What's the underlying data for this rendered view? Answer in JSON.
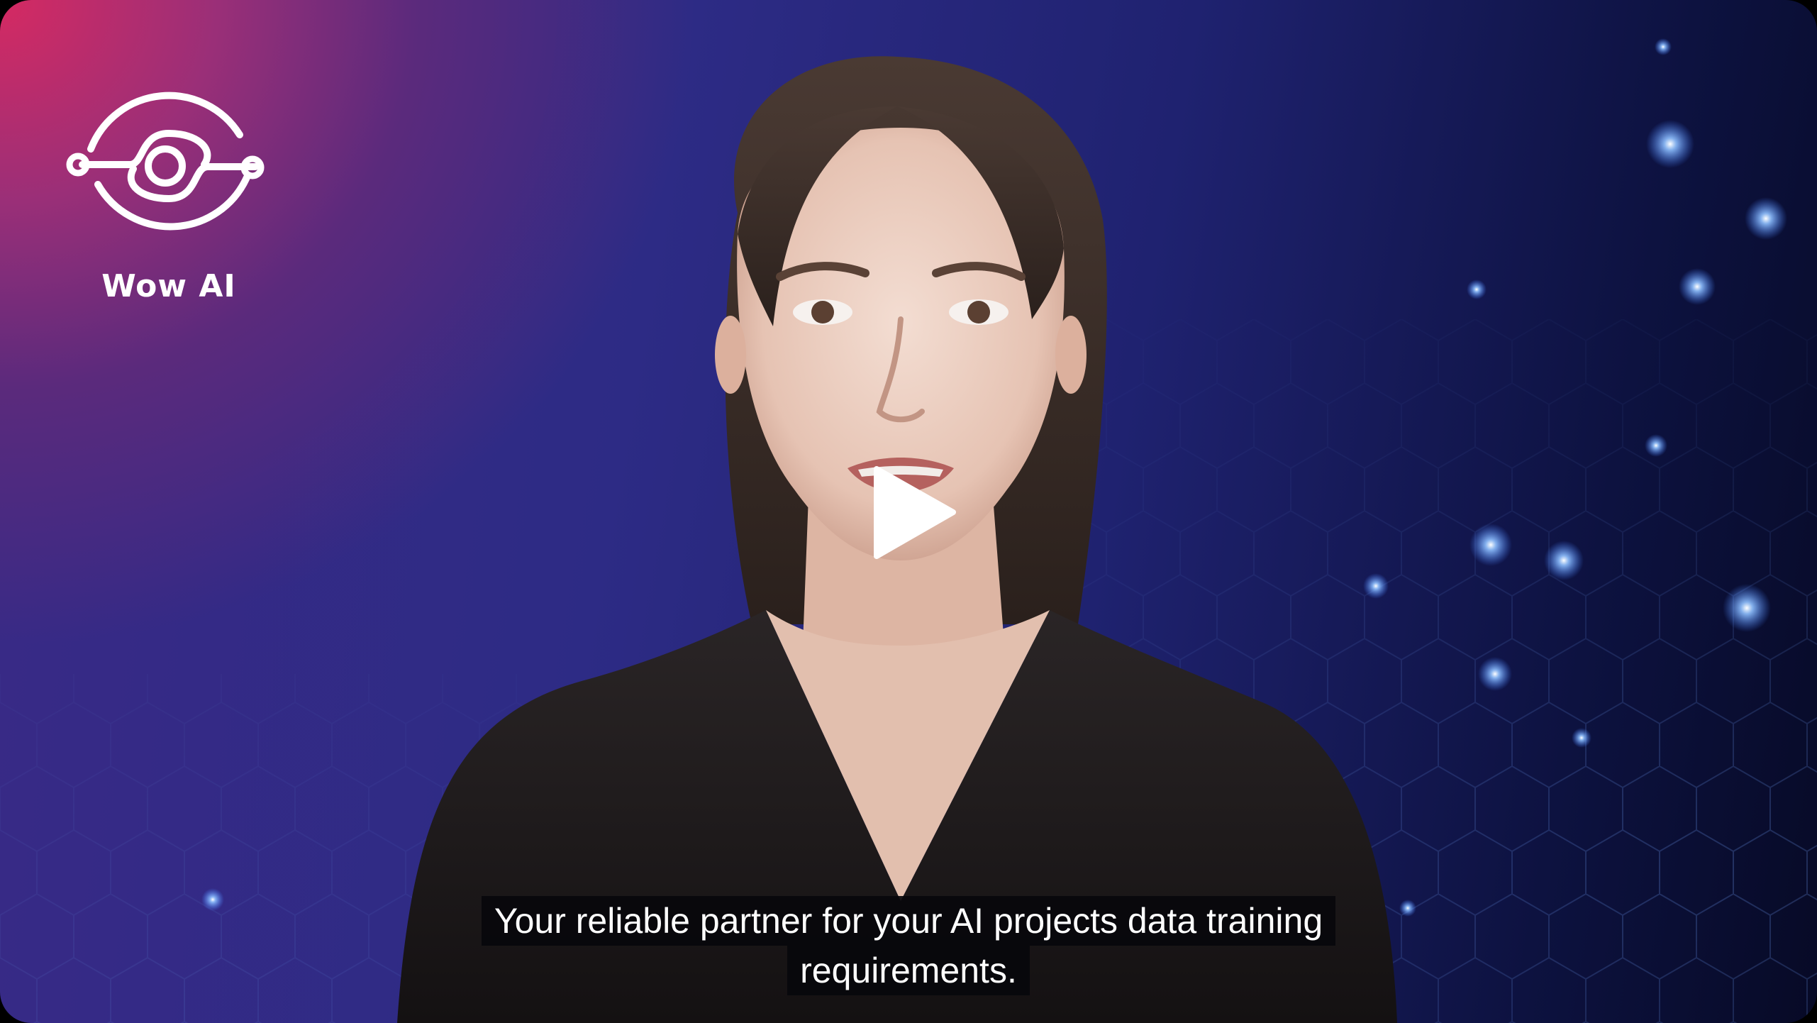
{
  "video": {
    "brand_name": "Wow AI",
    "caption_line_1": "Your reliable partner for your AI projects data training",
    "caption_line_2": "requirements."
  },
  "icons": {
    "logo": "wow-ai-logo-icon",
    "play": "play-icon"
  },
  "colors": {
    "gradient_pink": "#d52a62",
    "gradient_purple": "#5b2a7c",
    "gradient_navy": "#1f2270",
    "caption_background": "#08080c",
    "caption_text": "#ffffff",
    "glow_dots": "#6fa8ff"
  }
}
